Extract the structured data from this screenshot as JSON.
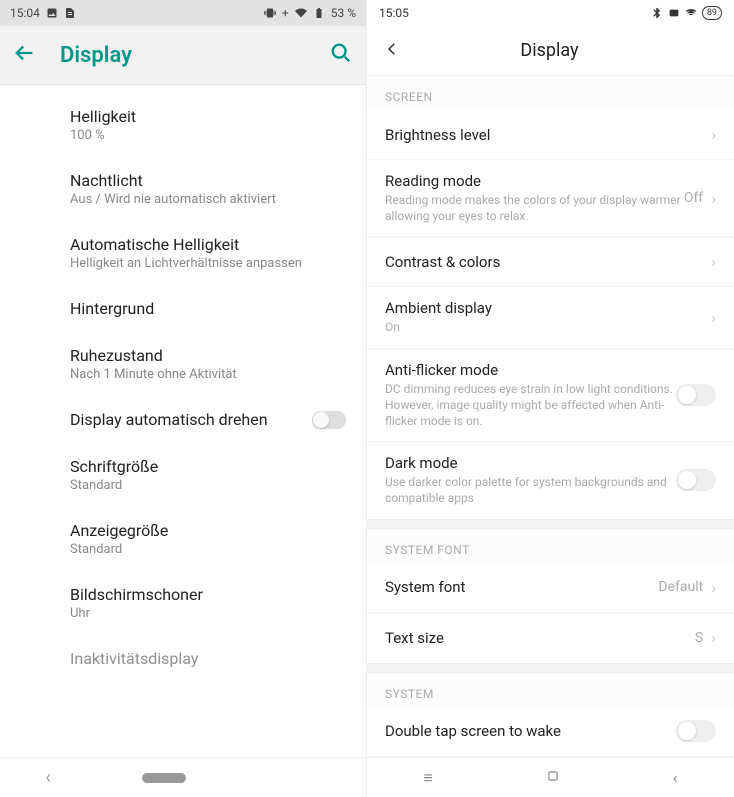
{
  "left": {
    "status": {
      "time": "15:04",
      "battery": "53 %"
    },
    "header": {
      "title": "Display"
    },
    "items": [
      {
        "title": "Helligkeit",
        "sub": "100 %"
      },
      {
        "title": "Nachtlicht",
        "sub": "Aus / Wird nie automatisch aktiviert"
      },
      {
        "title": "Automatische Helligkeit",
        "sub": "Helligkeit an Lichtverhältnisse anpassen"
      },
      {
        "title": "Hintergrund",
        "sub": ""
      },
      {
        "title": "Ruhezustand",
        "sub": "Nach 1 Minute ohne Aktivität"
      },
      {
        "title": "Display automatisch drehen",
        "sub": ""
      },
      {
        "title": "Schriftgröße",
        "sub": "Standard"
      },
      {
        "title": "Anzeigegröße",
        "sub": "Standard"
      },
      {
        "title": "Bildschirmschoner",
        "sub": "Uhr"
      },
      {
        "title": "Inaktivitätsdisplay",
        "sub": ""
      }
    ]
  },
  "right": {
    "status": {
      "time": "15:05",
      "battery": "89"
    },
    "header": {
      "title": "Display"
    },
    "sections": {
      "screen": "SCREEN",
      "systemfont": "SYSTEM FONT",
      "system": "SYSTEM"
    },
    "items": {
      "brightness": {
        "title": "Brightness level"
      },
      "reading": {
        "title": "Reading mode",
        "sub": "Reading mode makes the colors of your display warmer allowing your eyes to relax.",
        "value": "Off"
      },
      "contrast": {
        "title": "Contrast & colors"
      },
      "ambient": {
        "title": "Ambient display",
        "sub": "On"
      },
      "antiflicker": {
        "title": "Anti-flicker mode",
        "sub": "DC dimming reduces eye strain in low light conditions. However, image quality might be affected when Anti-flicker mode is on."
      },
      "darkmode": {
        "title": "Dark mode",
        "sub": "Use darker color palette for system backgrounds and compatible apps"
      },
      "systemfont": {
        "title": "System font",
        "value": "Default"
      },
      "textsize": {
        "title": "Text size",
        "value": "S"
      },
      "doubletap": {
        "title": "Double tap screen to wake"
      }
    }
  }
}
